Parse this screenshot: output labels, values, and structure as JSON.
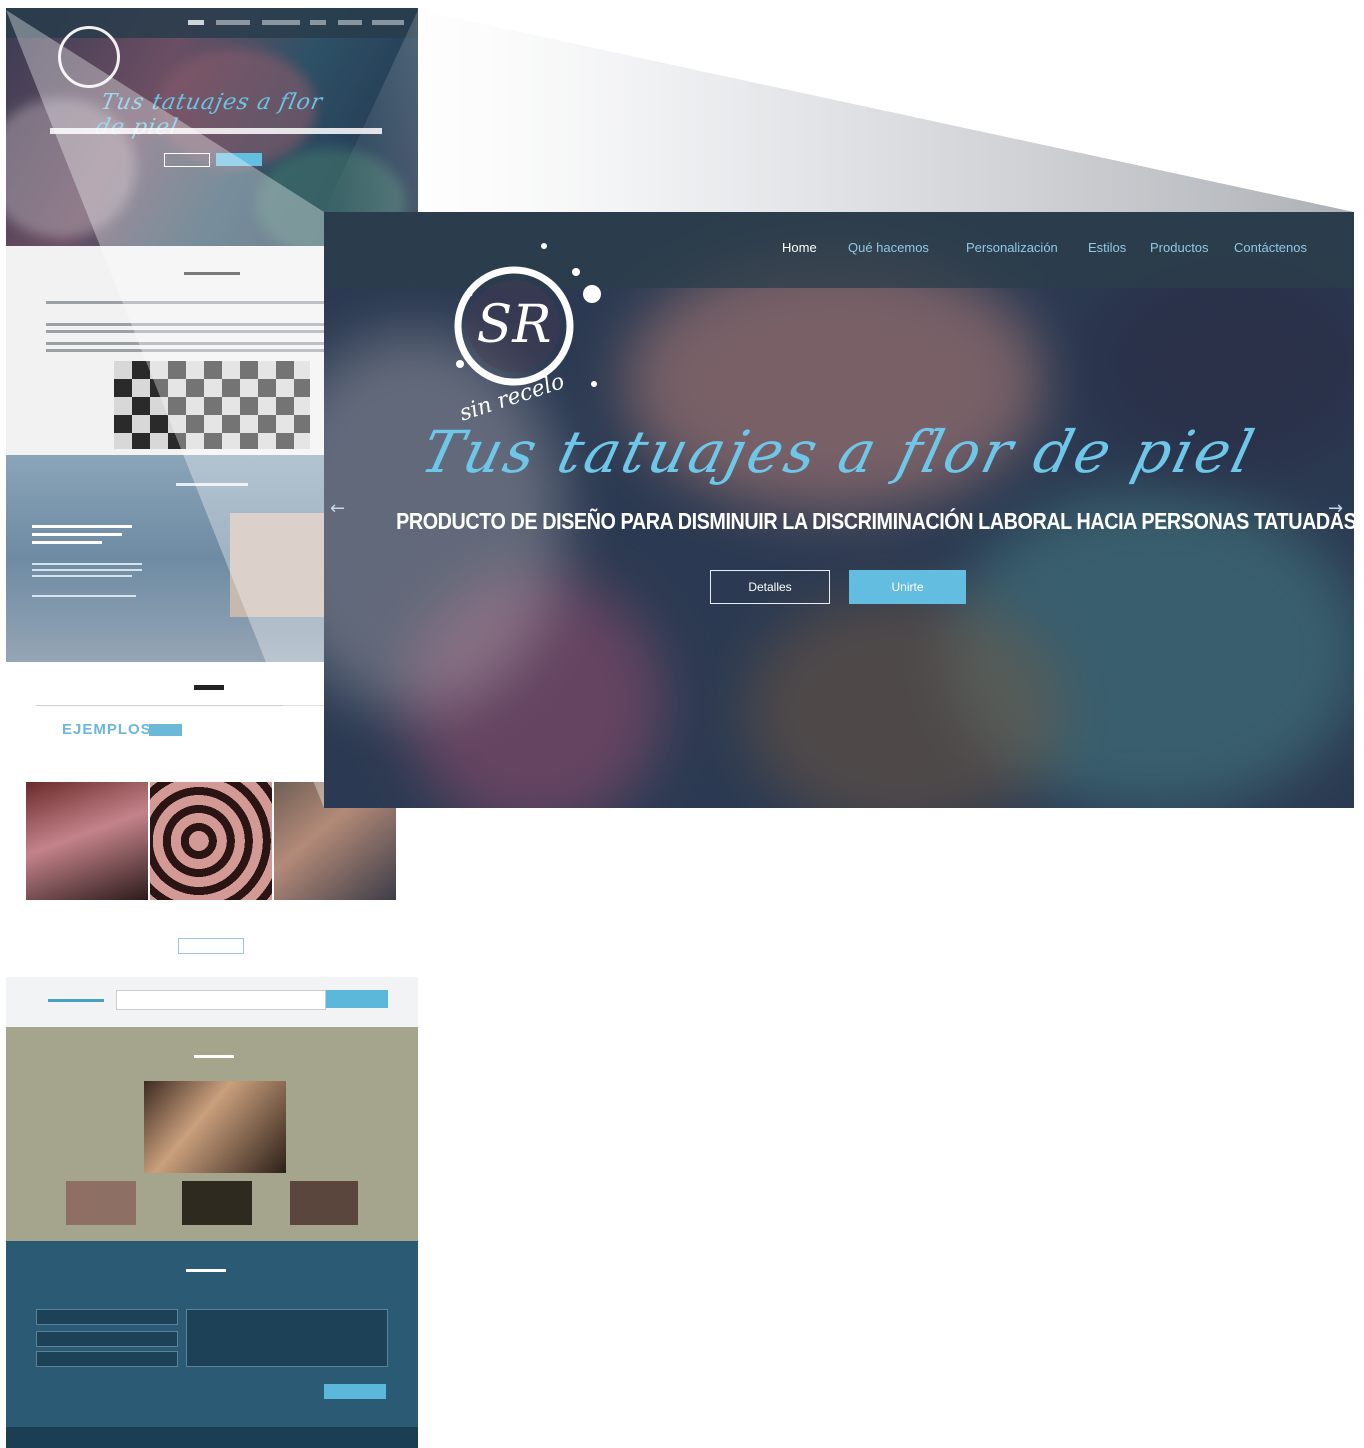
{
  "nav": {
    "items": [
      {
        "label": "Home",
        "active": true
      },
      {
        "label": "Qué hacemos",
        "active": false
      },
      {
        "label": "Personalización",
        "active": false
      },
      {
        "label": "Estilos",
        "active": false
      },
      {
        "label": "Productos",
        "active": false
      },
      {
        "label": "Contáctenos",
        "active": false
      }
    ]
  },
  "hero": {
    "logo_text": "SR",
    "logo_tagline": "sin recelo",
    "headline": "Tus tatuajes a flor de piel",
    "subhead": "PRODUCTO DE DISEÑO PARA DISMINUIR LA DISCRIMINACIÓN LABORAL HACIA PERSONAS TATUADAS",
    "btn_details": "Detalles",
    "btn_join": "Unirte",
    "prev_arrow": "←",
    "next_arrow": "→"
  },
  "mock": {
    "headline": "Tus tatuajes a flor de piel",
    "ejemplos": "EJEMPLOS"
  },
  "colors": {
    "accent": "#62bde0",
    "nav_bg": "#2c3e4a",
    "olive": "#a5a48d",
    "contact_bg": "#2b5b74"
  }
}
